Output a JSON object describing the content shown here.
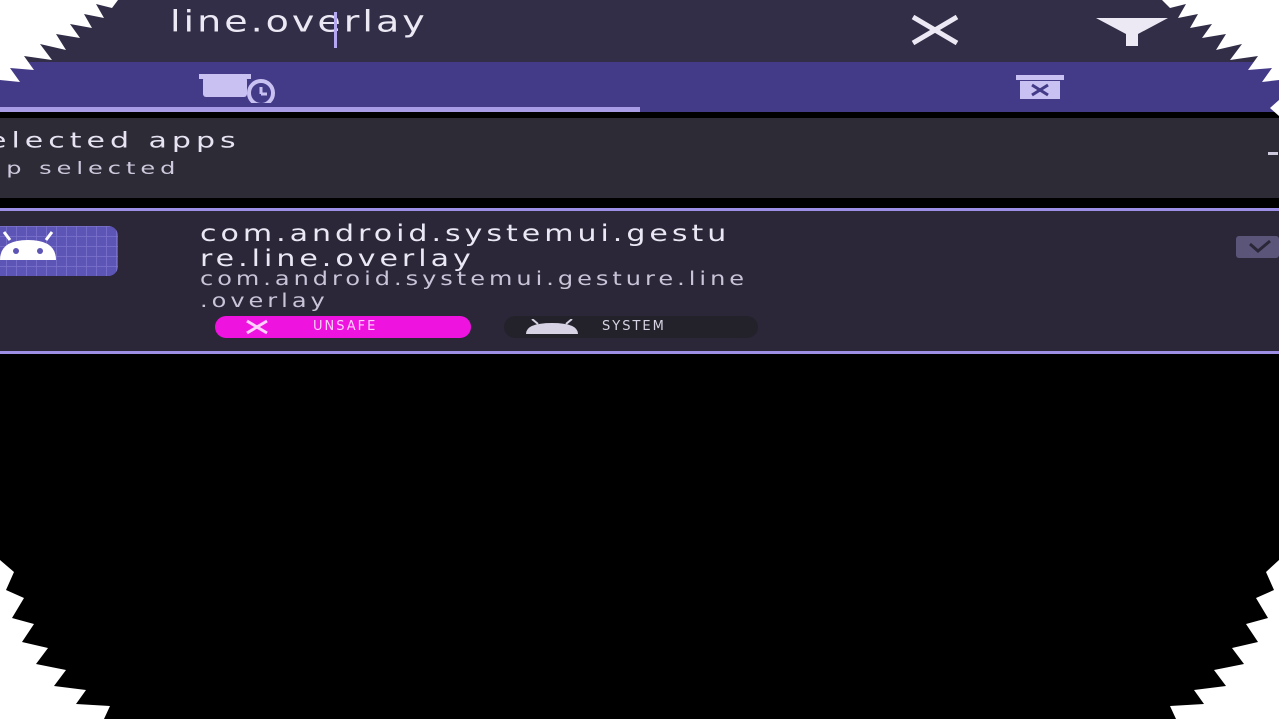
{
  "search": {
    "query": "line.overlay",
    "clear_icon": "close-icon",
    "filter_icon": "filter-icon"
  },
  "tabs": [
    {
      "icon": "scheduled-app-icon",
      "selected": true
    },
    {
      "icon": "trash-icon",
      "selected": false
    }
  ],
  "selected_header": {
    "title": "elected apps",
    "subtitle": "pp selected"
  },
  "app": {
    "label_line1": "com.android.systemui.gestu",
    "label_line2": "re.line.overlay",
    "package_line1": "com.android.systemui.gesture.line",
    "package_line2": ".overlay",
    "icon": "android-icon",
    "badges": [
      {
        "label": "UNSAFE",
        "icon": "close-icon",
        "color": "#ee13df"
      },
      {
        "label": "SYSTEM",
        "icon": "android-icon",
        "color": "#23222a"
      }
    ],
    "checked": true
  },
  "colors": {
    "accent": "#a89ce6",
    "tab_bg": "#433a88",
    "search_bg": "#332e47",
    "row_bg": "#2b2739",
    "unsafe": "#ee13df"
  }
}
